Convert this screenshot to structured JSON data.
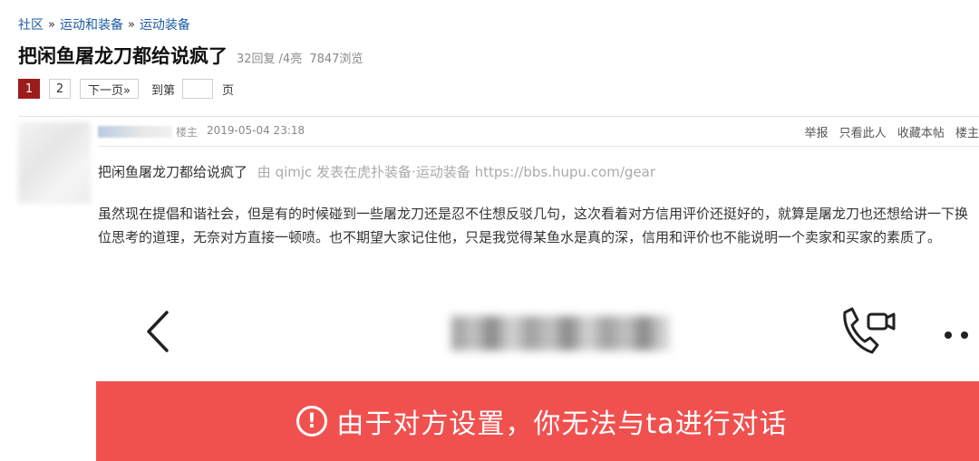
{
  "breadcrumb": {
    "items": [
      "社区",
      "运动和装备",
      "运动装备"
    ],
    "separator": "»"
  },
  "thread": {
    "title": "把闲鱼屠龙刀都给说疯了",
    "replies": "32回复",
    "lights": "/4亮",
    "views": "7847浏览"
  },
  "pager": {
    "pages": [
      "1",
      "2"
    ],
    "next_label": "下一页»",
    "goto_prefix": "到第",
    "goto_suffix": "页",
    "goto_value": ""
  },
  "post": {
    "op_badge": "楼主",
    "time": "2019-05-04 23:18",
    "actions": [
      "举报",
      "只看此人",
      "收藏本帖",
      "楼主"
    ],
    "quote_title": "把闲鱼屠龙刀都给说疯了",
    "quote_meta": "由 qimjc 发表在虎扑装备·运动装备 https://bbs.hupu.com/gear",
    "body": "虽然现在提倡和谐社会，但是有的时候碰到一些屠龙刀还是忍不住想反驳几句，这次看着对方信用评价还挺好的，就算是屠龙刀也还想给讲一下换位思考的道理，无奈对方直接一顿喷。也不期望大家记住他，只是我觉得某鱼水是真的深，信用和评价也不能说明一个卖家和买家的素质了。",
    "screenshot": {
      "banner_text": "由于对方设置，你无法与ta进行对话",
      "warning_glyph": "!",
      "icons": [
        "back-chevron-icon",
        "video-call-icon",
        "more-dots-icon"
      ],
      "banner_color": "#f0514f"
    }
  },
  "colors": {
    "link": "#1b5aa6",
    "active_page": "#9c1c1c"
  }
}
